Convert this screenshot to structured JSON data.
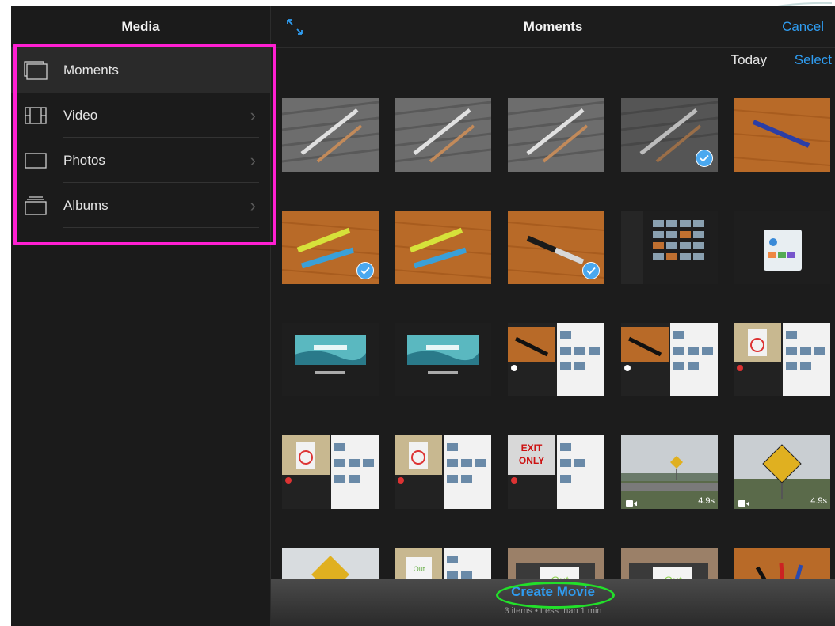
{
  "sidebar": {
    "title": "Media",
    "items": [
      {
        "label": "Moments",
        "icon": "moments-icon",
        "selected": true,
        "chevron": false
      },
      {
        "label": "Video",
        "icon": "film-icon",
        "selected": false,
        "chevron": true
      },
      {
        "label": "Photos",
        "icon": "photo-icon",
        "selected": false,
        "chevron": true
      },
      {
        "label": "Albums",
        "icon": "albums-icon",
        "selected": false,
        "chevron": true
      }
    ]
  },
  "header": {
    "title": "Moments",
    "cancel_label": "Cancel",
    "expand_icon": "expand-icon"
  },
  "section": {
    "date_label": "Today",
    "select_label": "Select"
  },
  "thumbnails": [
    {
      "kind": "pens-gray",
      "selected": false
    },
    {
      "kind": "pens-gray",
      "selected": false
    },
    {
      "kind": "pens-gray",
      "selected": false
    },
    {
      "kind": "pens-gray-dim",
      "selected": true
    },
    {
      "kind": "pen-blue-wood",
      "selected": false
    },
    {
      "kind": "highlighters-wood",
      "selected": true
    },
    {
      "kind": "highlighters-wood",
      "selected": false
    },
    {
      "kind": "marker-wood",
      "selected": true
    },
    {
      "kind": "screen-grid",
      "selected": false
    },
    {
      "kind": "screen-share",
      "selected": false
    },
    {
      "kind": "first-day",
      "selected": false
    },
    {
      "kind": "first-day",
      "selected": false
    },
    {
      "kind": "editor-marker",
      "selected": false
    },
    {
      "kind": "editor-marker",
      "selected": false
    },
    {
      "kind": "editor-nosmoking",
      "selected": false
    },
    {
      "kind": "editor-nosmoking",
      "selected": false
    },
    {
      "kind": "editor-nosmoking",
      "selected": false
    },
    {
      "kind": "editor-exit",
      "selected": false
    },
    {
      "kind": "video-road",
      "selected": false,
      "duration": "4.9s"
    },
    {
      "kind": "video-sign",
      "selected": false,
      "duration": "4.9s"
    },
    {
      "kind": "sign-sky",
      "selected": false
    },
    {
      "kind": "editor-outoforder",
      "selected": false
    },
    {
      "kind": "printer-out",
      "selected": false
    },
    {
      "kind": "printer-out",
      "selected": false
    },
    {
      "kind": "markers-wood",
      "selected": false
    }
  ],
  "footer": {
    "create_label": "Create Movie",
    "summary": "3 items • Less than 1 min"
  },
  "colors": {
    "accent": "#2f9cf0",
    "highlight_box": "#ff1fd2",
    "highlight_ellipse": "#22e02a"
  }
}
